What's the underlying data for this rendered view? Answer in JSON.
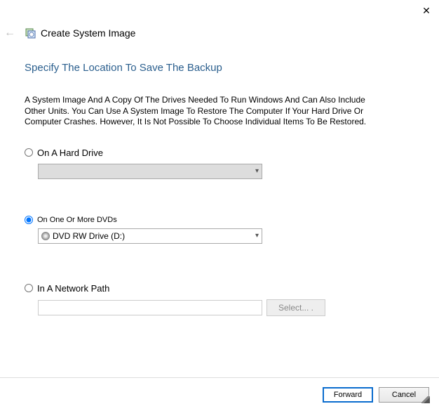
{
  "window": {
    "title": "Create System Image"
  },
  "heading": "Specify The Location To Save The Backup",
  "description": "A System Image And A Copy Of The Drives Needed To Run Windows And Can Also Include Other Units. You Can Use A System Image To Restore The Computer If Your Hard Drive Or Computer Crashes. However, It Is Not Possible To Choose Individual Items To Be Restored.",
  "options": {
    "hard_drive": {
      "label": "On A Hard Drive",
      "selected": false,
      "enabled": false,
      "value": ""
    },
    "dvd": {
      "label": "On One Or More DVDs",
      "selected": true,
      "enabled": true,
      "value": "DVD RW Drive (D:)"
    },
    "network": {
      "label": "In A Network Path",
      "selected": false,
      "value": "",
      "select_button": "Select... ."
    }
  },
  "footer": {
    "forward": "Forward",
    "cancel": "Cancel"
  }
}
